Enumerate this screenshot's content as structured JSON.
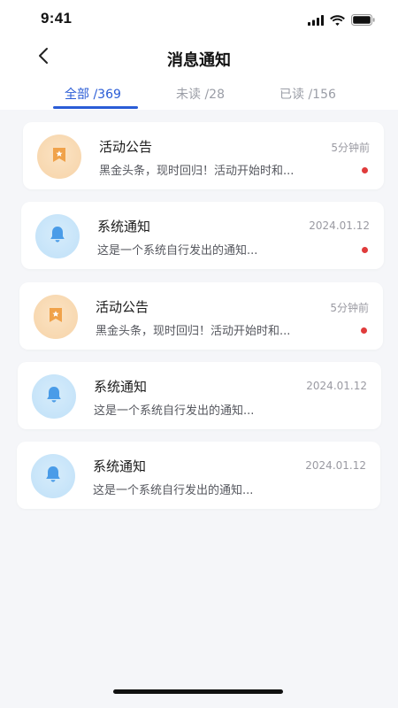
{
  "status_bar": {
    "time": "9:41",
    "icons": [
      "signal-icon",
      "wifi-icon",
      "battery-icon"
    ]
  },
  "header": {
    "title": "消息通知",
    "back_icon": "chevron-left-icon"
  },
  "tabs": [
    {
      "label": "全部 /369",
      "active": true
    },
    {
      "label": "未读 /28",
      "active": false
    },
    {
      "label": "已读 /156",
      "active": false
    }
  ],
  "colors": {
    "accent": "#2a5cd6",
    "unread_dot": "#e03b3b",
    "announcement_icon_bg": "#f6d3a8",
    "system_icon_bg": "#bfe0f8"
  },
  "notifications": [
    {
      "type": "announcement",
      "icon": "announcement-flag-icon",
      "title": "活动公告",
      "time": "5分钟前",
      "preview": "黑金头条，现时回归！活动开始时和...",
      "unread": true
    },
    {
      "type": "system",
      "icon": "bell-icon",
      "title": "系统通知",
      "time": "2024.01.12",
      "preview": "这是一个系统自行发出的通知...",
      "unread": true
    },
    {
      "type": "announcement",
      "icon": "announcement-flag-icon",
      "title": "活动公告",
      "time": "5分钟前",
      "preview": "黑金头条，现时回归！活动开始时和...",
      "unread": true
    },
    {
      "type": "system",
      "icon": "bell-icon",
      "title": "系统通知",
      "time": "2024.01.12",
      "preview": "这是一个系统自行发出的通知...",
      "unread": false
    },
    {
      "type": "system",
      "icon": "bell-icon",
      "title": "系统通知",
      "time": "2024.01.12",
      "preview": "这是一个系统自行发出的通知...",
      "unread": false
    }
  ]
}
